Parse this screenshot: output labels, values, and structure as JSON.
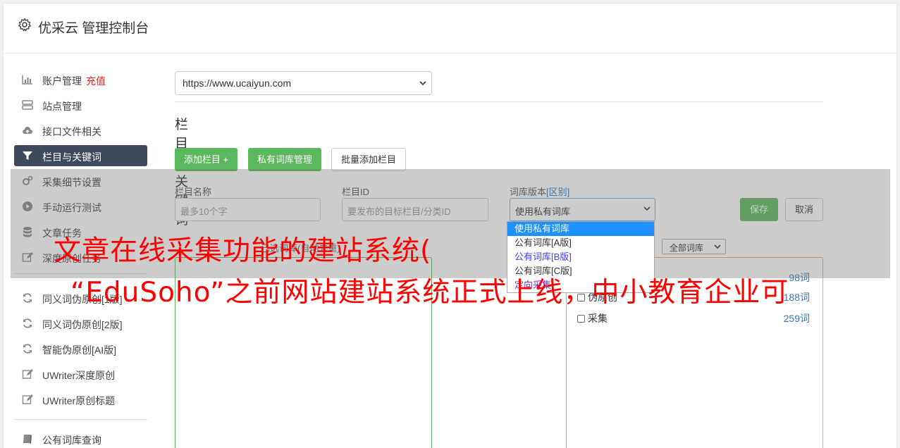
{
  "app": {
    "title": "优采云 管理控制台"
  },
  "sidebar": {
    "items": [
      {
        "label": "账户管理",
        "badge": "充值",
        "icon": "bar-chart-icon"
      },
      {
        "label": "站点管理",
        "icon": "server-icon"
      },
      {
        "label": "接口文件相关",
        "icon": "cloud-upload-icon"
      },
      {
        "label": "栏目与关键词",
        "icon": "filter-icon",
        "active": true
      },
      {
        "label": "采集细节设置",
        "icon": "cogs-icon"
      },
      {
        "label": "手动运行测试",
        "icon": "play-circle-icon"
      },
      {
        "label": "文章任务",
        "icon": "database-icon"
      },
      {
        "label": "深度原创任务",
        "icon": "edit-icon"
      },
      {
        "label": "同义词伪原创[1版]",
        "icon": "refresh-icon"
      },
      {
        "label": "同义词伪原创[2版]",
        "icon": "refresh-icon"
      },
      {
        "label": "智能伪原创[AI版]",
        "icon": "refresh-icon"
      },
      {
        "label": "UWriter深度原创",
        "icon": "edit-icon"
      },
      {
        "label": "UWriter原创标题",
        "icon": "edit-icon"
      },
      {
        "label": "公有词库查询",
        "icon": "book-icon"
      }
    ]
  },
  "main": {
    "site_select": {
      "value": "https://www.ucaiyun.com"
    },
    "section_title": "栏目与关键词",
    "buttons": {
      "add_column": "添加栏目 +",
      "private_lib": "私有词库管理",
      "batch_add": "批量添加栏目"
    },
    "form": {
      "name_label": "栏目名称",
      "name_placeholder": "最多10个字",
      "id_label": "栏目ID",
      "id_placeholder": "要发布的目标栏目/分类ID",
      "lib_label": "词库版本",
      "lib_label_link": "[区别]",
      "lib_value": "使用私有词库",
      "save": "保存",
      "cancel": "取消"
    },
    "lib_dropdown": {
      "options": [
        "使用私有词库",
        "公有词库[A版]",
        "公有词库[B版]",
        "公有词库[C版]",
        "定向采集"
      ],
      "selected_index": 0
    },
    "filter": {
      "left_hint": "已选词库(自动去重)",
      "all_libs": "全部词库"
    },
    "lib_list": [
      {
        "label": "",
        "count": "98词"
      },
      {
        "label": "伪原创",
        "count": "188词"
      },
      {
        "label": "采集",
        "count": "259词"
      }
    ]
  },
  "watermark": {
    "line1": "文章在线采集功能的建站系统(",
    "line2": "“EduSoho”之前网站建站系统正式上线，中小教育企业可"
  },
  "colors": {
    "accent_green": "#5cb85c",
    "nav_active": "#3e4a5b",
    "badge_red": "#e02020",
    "link_blue": "#337ab7",
    "watermark_red": "#ff0000"
  }
}
